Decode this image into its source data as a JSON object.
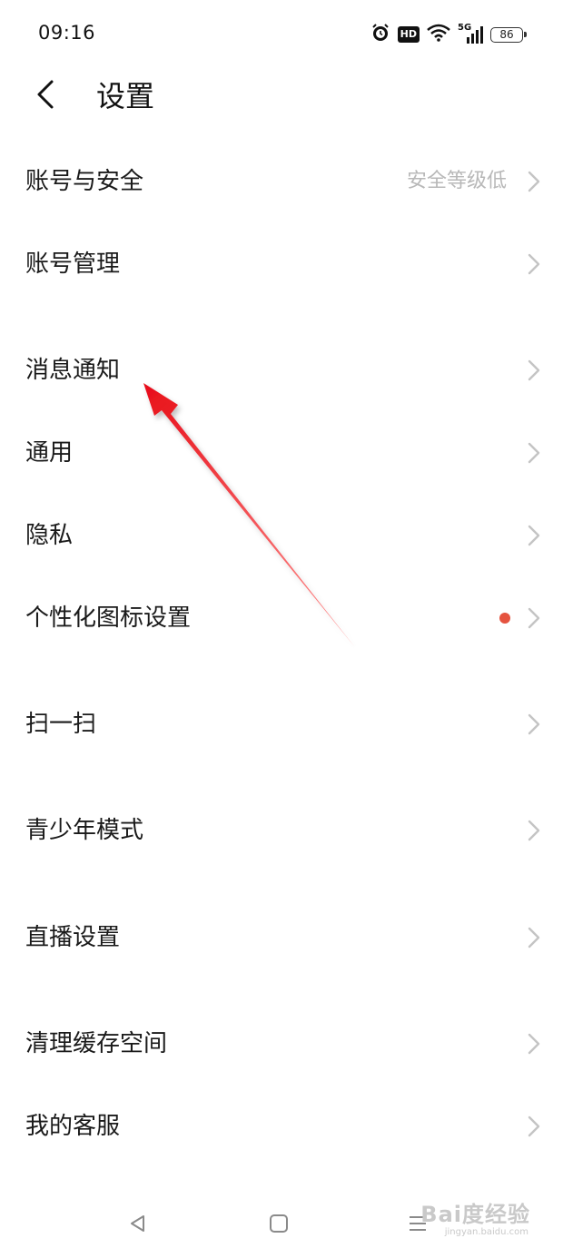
{
  "status_bar": {
    "time": "09:16",
    "network_label": "5G",
    "battery_level": "86",
    "icons": [
      "alarm-icon",
      "hd-icon",
      "wifi-icon",
      "signal-5g-icon",
      "battery-icon"
    ]
  },
  "header": {
    "title": "设置",
    "back_icon": "chevron-left-icon"
  },
  "settings": [
    {
      "label": "账号与安全",
      "value": "安全等级低"
    },
    {
      "label": "账号管理"
    },
    {
      "label": "消息通知"
    },
    {
      "label": "通用"
    },
    {
      "label": "隐私"
    },
    {
      "label": "个性化图标设置",
      "badge": "red-dot"
    },
    {
      "label": "扫一扫"
    },
    {
      "label": "青少年模式"
    },
    {
      "label": "直播设置"
    },
    {
      "label": "清理缓存空间"
    },
    {
      "label": "我的客服"
    }
  ],
  "nav_bar": {
    "items": [
      "back-triangle-icon",
      "home-square-icon",
      "menu-lines-icon"
    ]
  },
  "watermark": {
    "text": "Bai度经验",
    "url": "jingyan.baidu.com"
  },
  "colors": {
    "background": "#ffffff",
    "text": "#1a1a1a",
    "secondary_text": "#b8b8b8",
    "chevron": "#c4c4c4",
    "badge": "#e5533f",
    "annotation_arrow": "#e8101a"
  }
}
